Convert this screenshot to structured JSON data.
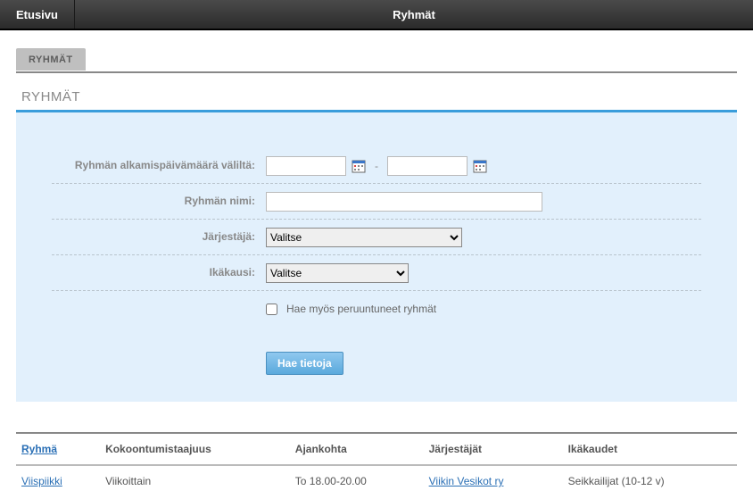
{
  "nav": {
    "home": "Etusivu",
    "groups": "Ryhmät"
  },
  "tabs": {
    "groups": "RYHMÄT"
  },
  "section_title": "RYHMÄT",
  "form": {
    "date_range_label": "Ryhmän alkamispäivämäärä väliltä:",
    "date_from": "",
    "date_to": "",
    "name_label": "Ryhmän nimi:",
    "name_value": "",
    "organizer_label": "Järjestäjä:",
    "organizer_selected": "Valitse",
    "age_label": "Ikäkausi:",
    "age_selected": "Valitse",
    "cancelled_label": "Hae myös peruuntuneet ryhmät",
    "submit": "Hae tietoja"
  },
  "table": {
    "headers": {
      "group": "Ryhmä",
      "frequency": "Kokoontumistaajuus",
      "time": "Ajankohta",
      "organizers": "Järjestäjät",
      "ages": "Ikäkaudet"
    },
    "rows": [
      {
        "group": "Viispiikki",
        "frequency": "Viikoittain",
        "time": "To 18.00-20.00",
        "organizers": "Viikin Vesikot ry",
        "ages": "Seikkailijat (10-12 v)"
      }
    ]
  }
}
